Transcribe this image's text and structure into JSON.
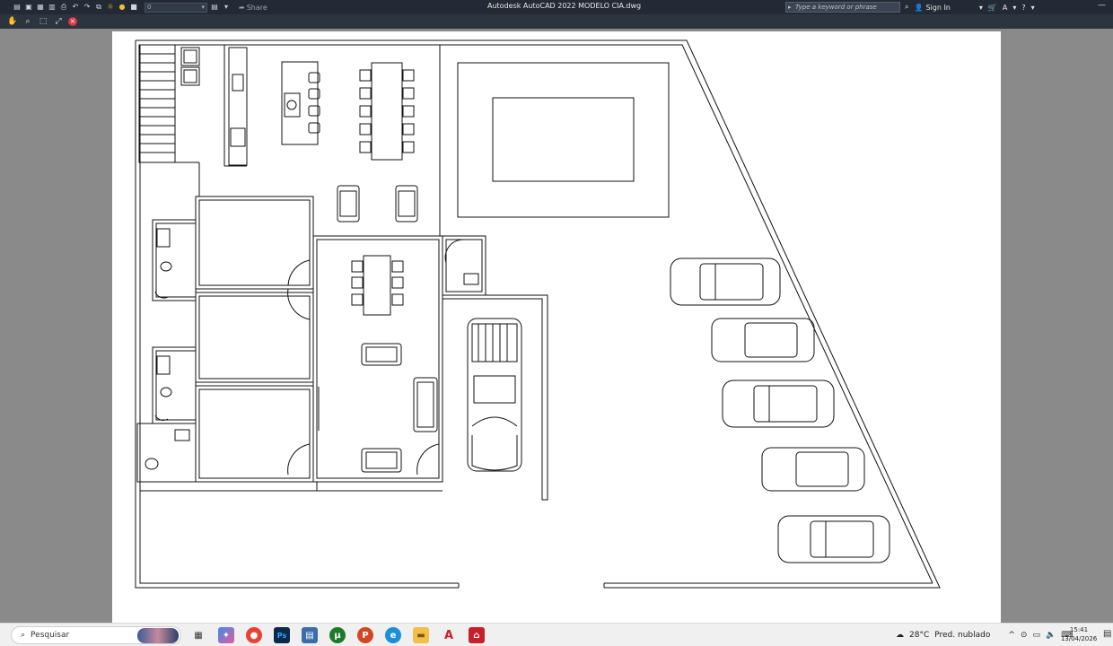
{
  "titlebar": {
    "app_title": "Autodesk AutoCAD 2022   MODELO CIA.dwg",
    "workspace_value": "0",
    "share_label": "Share",
    "search_placeholder": "Type a keyword or phrase",
    "sign_in_label": "Sign In",
    "icons": [
      "open-icon",
      "save-icon",
      "saveas-icon",
      "plot-icon",
      "print-icon",
      "undo-icon",
      "redo-icon",
      "layer-icon",
      "sun-icon",
      "lightbulb-icon",
      "square-icon"
    ]
  },
  "toolbar2": {
    "icons": [
      "pan-icon",
      "zoom-icon",
      "zoom-window-icon",
      "extents-icon",
      "close-drawing-icon"
    ]
  },
  "colors": {
    "titlebar_bg": "#232a35",
    "canvas_bg": "#8a8a8a",
    "paper_bg": "#ffffff",
    "line_color": "#111111",
    "close_red": "#d9363e",
    "taskbar_bg": "#f0f0f0"
  },
  "taskbar": {
    "search_placeholder": "Pesquisar",
    "apps": [
      "task-view",
      "copilot",
      "chrome",
      "photoshop",
      "calculator",
      "utorrent",
      "powerpoint",
      "edge",
      "file-explorer",
      "autocad",
      "acrobat"
    ],
    "weather_temp": "28°C",
    "weather_desc": "Pred. nublado",
    "time": "15:41",
    "date": "13/04/2026"
  }
}
